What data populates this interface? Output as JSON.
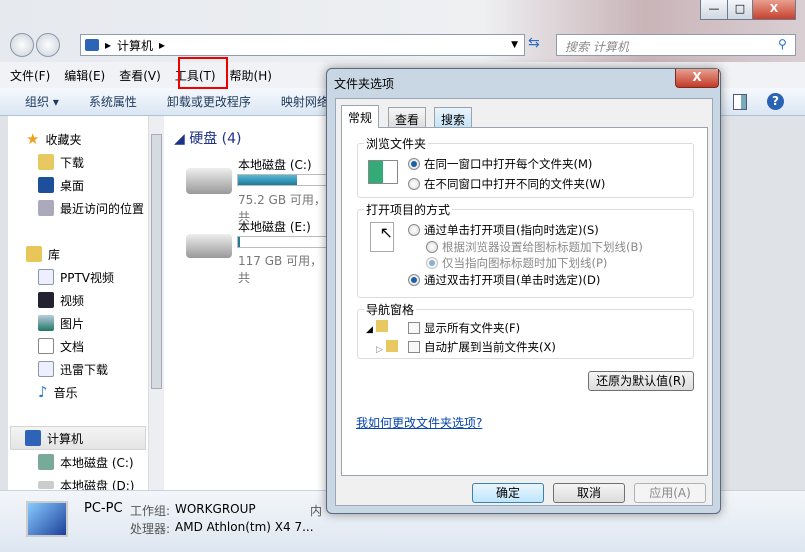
{
  "window": {
    "minimize": "—",
    "maximize": "□",
    "close": "X"
  },
  "address": {
    "crumb": "计算机",
    "refresh_icon": "refresh-icon"
  },
  "search": {
    "placeholder": "搜索 计算机"
  },
  "menu": [
    "文件(F)",
    "编辑(E)",
    "查看(V)",
    "工具(T)",
    "帮助(H)"
  ],
  "toolbar": [
    "组织 ▾",
    "系统属性",
    "卸载或更改程序",
    "映射网络"
  ],
  "nav": {
    "favorites": "收藏夹",
    "fav_items": [
      "下载",
      "桌面",
      "最近访问的位置"
    ],
    "libraries": "库",
    "lib_items": [
      "PPTV视频",
      "视频",
      "图片",
      "文档",
      "迅雷下载",
      "音乐"
    ],
    "computer": "计算机",
    "comp_items": [
      "本地磁盘 (C:)",
      "本地磁盘 (D:)"
    ]
  },
  "content": {
    "group": "硬盘 (4)",
    "drives": [
      {
        "name": "本地磁盘 (C:)",
        "free": "75.2 GB 可用，共",
        "used_pct": 60
      },
      {
        "name": "本地磁盘 (E:)",
        "free": "117 GB 可用，共",
        "used_pct": 2
      }
    ]
  },
  "status": {
    "name": "PC-PC",
    "workgroup_label": "工作组:",
    "workgroup": "WORKGROUP",
    "cpu_label": "处理器:",
    "cpu": "AMD Athlon(tm) X4 7...",
    "mem": "内"
  },
  "dialog": {
    "title": "文件夹选项",
    "tabs": [
      "常规",
      "查看",
      "搜索"
    ],
    "browse": {
      "label": "浏览文件夹",
      "opts": [
        "在同一窗口中打开每个文件夹(M)",
        "在不同窗口中打开不同的文件夹(W)"
      ],
      "selected": 0
    },
    "click": {
      "label": "打开项目的方式",
      "single": "通过单击打开项目(指向时选定)(S)",
      "sub": [
        "根据浏览器设置给图标标题加下划线(B)",
        "仅当指向图标标题时加下划线(P)"
      ],
      "double": "通过双击打开项目(单击时选定)(D)",
      "selected": "double"
    },
    "navpane": {
      "label": "导航窗格",
      "opts": [
        "显示所有文件夹(F)",
        "自动扩展到当前文件夹(X)"
      ],
      "checked": [
        false,
        false
      ]
    },
    "restore": "还原为默认值(R)",
    "link": "我如何更改文件夹选项?",
    "ok": "确定",
    "cancel": "取消",
    "apply": "应用(A)"
  },
  "colors": {
    "highlight": "#e00000",
    "link": "#0645ad",
    "bar": "#1e8fb0"
  }
}
